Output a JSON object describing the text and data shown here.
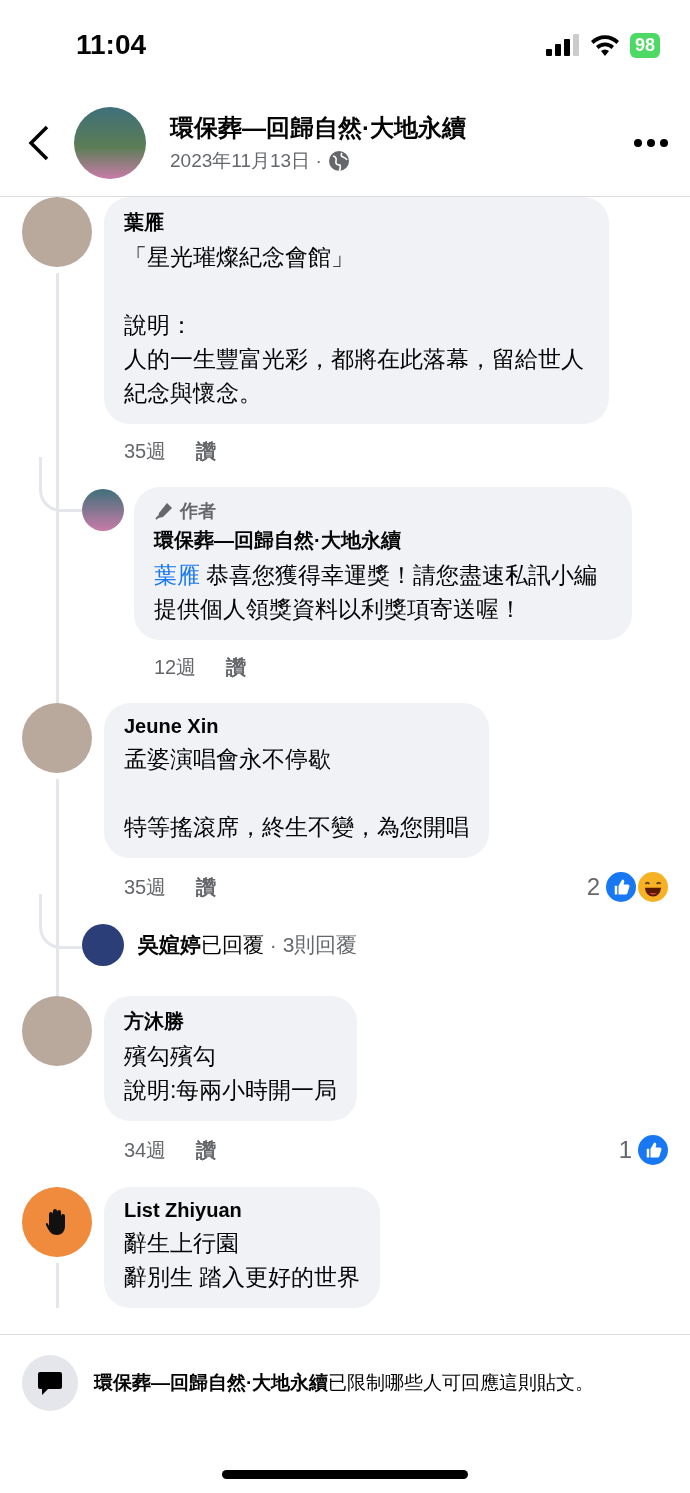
{
  "status_bar": {
    "time": "11:04",
    "battery": "98"
  },
  "header": {
    "title": "環保葬—回歸自然·大地永續",
    "date": "2023年11月13日 ·"
  },
  "comments": [
    {
      "author": "葉雁",
      "avatar": {
        "kind": "photo"
      },
      "paragraphs": [
        [
          "「星光璀燦紀念會館」"
        ],
        [
          "說明：",
          "人的一生豐富光彩，都將在此落幕，留給世人紀念與懷念。"
        ]
      ],
      "time": "35週",
      "like": "讚",
      "thread": true,
      "replies": [
        {
          "badge": "作者",
          "author": "環保葬—回歸自然·大地永續",
          "mention": "葉雁",
          "text": "恭喜您獲得幸運獎！請您盡速私訊小編提供個人領獎資料以利獎項寄送喔！",
          "time": "12週",
          "like": "讚"
        }
      ]
    },
    {
      "author": "Jeune Xin",
      "avatar": {
        "kind": "photo"
      },
      "paragraphs": [
        [
          "孟婆演唱會永不停歇"
        ],
        [
          "特等搖滾席，終生不變，為您開唱"
        ]
      ],
      "time": "35週",
      "like": "讚",
      "thread": true,
      "reaction_count": "2",
      "reactions": [
        {
          "kind": "like"
        },
        {
          "kind": "haha"
        }
      ],
      "reply_summary": {
        "name": "吳媗婷",
        "action": "已回覆",
        "count": "· 3則回覆"
      }
    },
    {
      "author": "方沐勝",
      "avatar": {
        "kind": "photo"
      },
      "paragraphs": [
        [
          "殯勾殯勾",
          "說明:每兩小時開一局"
        ]
      ],
      "time": "34週",
      "like": "讚",
      "thread": false,
      "reaction_count": "1",
      "reactions": [
        {
          "kind": "like"
        }
      ]
    },
    {
      "author": "List Zhiyuan",
      "avatar": {
        "kind": "sign"
      },
      "paragraphs": [
        [
          "辭生上行園",
          "辭別生 踏入更好的世界"
        ]
      ],
      "thread": true
    }
  ],
  "footer": {
    "notice": "**環保葬—回歸自然·大地永續**已限制哪些人可回應這則貼文。"
  }
}
